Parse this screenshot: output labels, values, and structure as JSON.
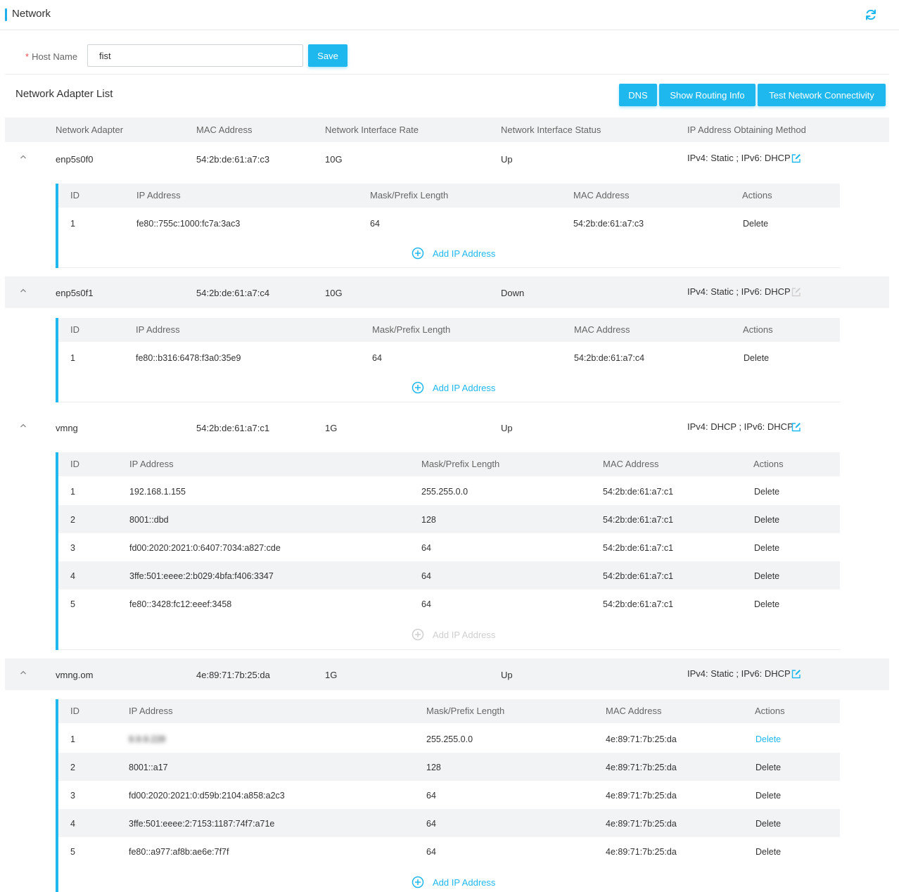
{
  "header": {
    "title": "Network",
    "refresh_icon": "refresh-icon"
  },
  "host": {
    "label": "Host Name",
    "required_mark": "*",
    "value": "fist",
    "save_label": "Save"
  },
  "adapter_list": {
    "title": "Network Adapter List",
    "buttons": {
      "dns": "DNS",
      "routing": "Show Routing Info",
      "test": "Test Network Connectivity"
    },
    "columns": [
      "Network Adapter",
      "MAC Address",
      "Network Interface Rate",
      "Network Interface Status",
      "IP Address Obtaining Method"
    ],
    "sub_columns": [
      "ID",
      "IP Address",
      "Mask/Prefix Length",
      "MAC Address",
      "Actions"
    ],
    "add_ip_label": "Add IP Address",
    "adapters": [
      {
        "name": "enp5s0f0",
        "mac": "54:2b:de:61:a7:c3",
        "rate": "10G",
        "status": "Up",
        "ip_method": "IPv4: Static ; IPv6: DHCP",
        "edit_enabled": true,
        "ips": [
          {
            "id": "1",
            "ip": "fe80::755c:1000:fc7a:3ac3",
            "mask": "64",
            "mac": "54:2b:de:61:a7:c3",
            "action": "Delete"
          }
        ]
      },
      {
        "name": "enp5s0f1",
        "mac": "54:2b:de:61:a7:c4",
        "rate": "10G",
        "status": "Down",
        "ip_method": "IPv4: Static ; IPv6: DHCP",
        "edit_enabled": false,
        "ips": [
          {
            "id": "1",
            "ip": "fe80::b316:6478:f3a0:35e9",
            "mask": "64",
            "mac": "54:2b:de:61:a7:c4",
            "action": "Delete"
          }
        ]
      },
      {
        "name": "vmng",
        "mac": "54:2b:de:61:a7:c1",
        "rate": "1G",
        "status": "Up",
        "ip_method": "IPv4: DHCP ; IPv6: DHCP",
        "edit_enabled": true,
        "ips": [
          {
            "id": "1",
            "ip": "192.168.1.155",
            "mask": "255.255.0.0",
            "mac": "54:2b:de:61:a7:c1",
            "action": "Delete"
          },
          {
            "id": "2",
            "ip": "8001::dbd",
            "mask": "128",
            "mac": "54:2b:de:61:a7:c1",
            "action": "Delete"
          },
          {
            "id": "3",
            "ip": "fd00:2020:2021:0:6407:7034:a827:cde",
            "mask": "64",
            "mac": "54:2b:de:61:a7:c1",
            "action": "Delete"
          },
          {
            "id": "4",
            "ip": "3ffe:501:eeee:2:b029:4bfa:f406:3347",
            "mask": "64",
            "mac": "54:2b:de:61:a7:c1",
            "action": "Delete"
          },
          {
            "id": "5",
            "ip": "fe80::3428:fc12:eeef:3458",
            "mask": "64",
            "mac": "54:2b:de:61:a7:c1",
            "action": "Delete"
          }
        ]
      },
      {
        "name": "vmng.om",
        "mac": "4e:89:71:7b:25:da",
        "rate": "1G",
        "status": "Up",
        "ip_method": "IPv4: Static ; IPv6: DHCP",
        "edit_enabled": true,
        "ips": [
          {
            "id": "1",
            "ip": "9.9.9.228",
            "mask": "255.255.0.0",
            "mac": "4e:89:71:7b:25:da",
            "action": "Delete"
          },
          {
            "id": "2",
            "ip": "8001::a17",
            "mask": "128",
            "mac": "4e:89:71:7b:25:da",
            "action": "Delete"
          },
          {
            "id": "3",
            "ip": "fd00:2020:2021:0:d59b:2104:a858:a2c3",
            "mask": "64",
            "mac": "4e:89:71:7b:25:da",
            "action": "Delete"
          },
          {
            "id": "4",
            "ip": "3ffe:501:eeee:2:7153:1187:74f7:a71e",
            "mask": "64",
            "mac": "4e:89:71:7b:25:da",
            "action": "Delete"
          },
          {
            "id": "5",
            "ip": "fe80::a977:af8b:ae6e:7f7f",
            "mask": "64",
            "mac": "4e:89:71:7b:25:da",
            "action": "Delete"
          }
        ]
      }
    ]
  },
  "colors": {
    "accent": "#1fb8ee",
    "header_bg": "#f2f3f5",
    "disabled": "#c8c8c8",
    "required": "#ee4d4d"
  }
}
